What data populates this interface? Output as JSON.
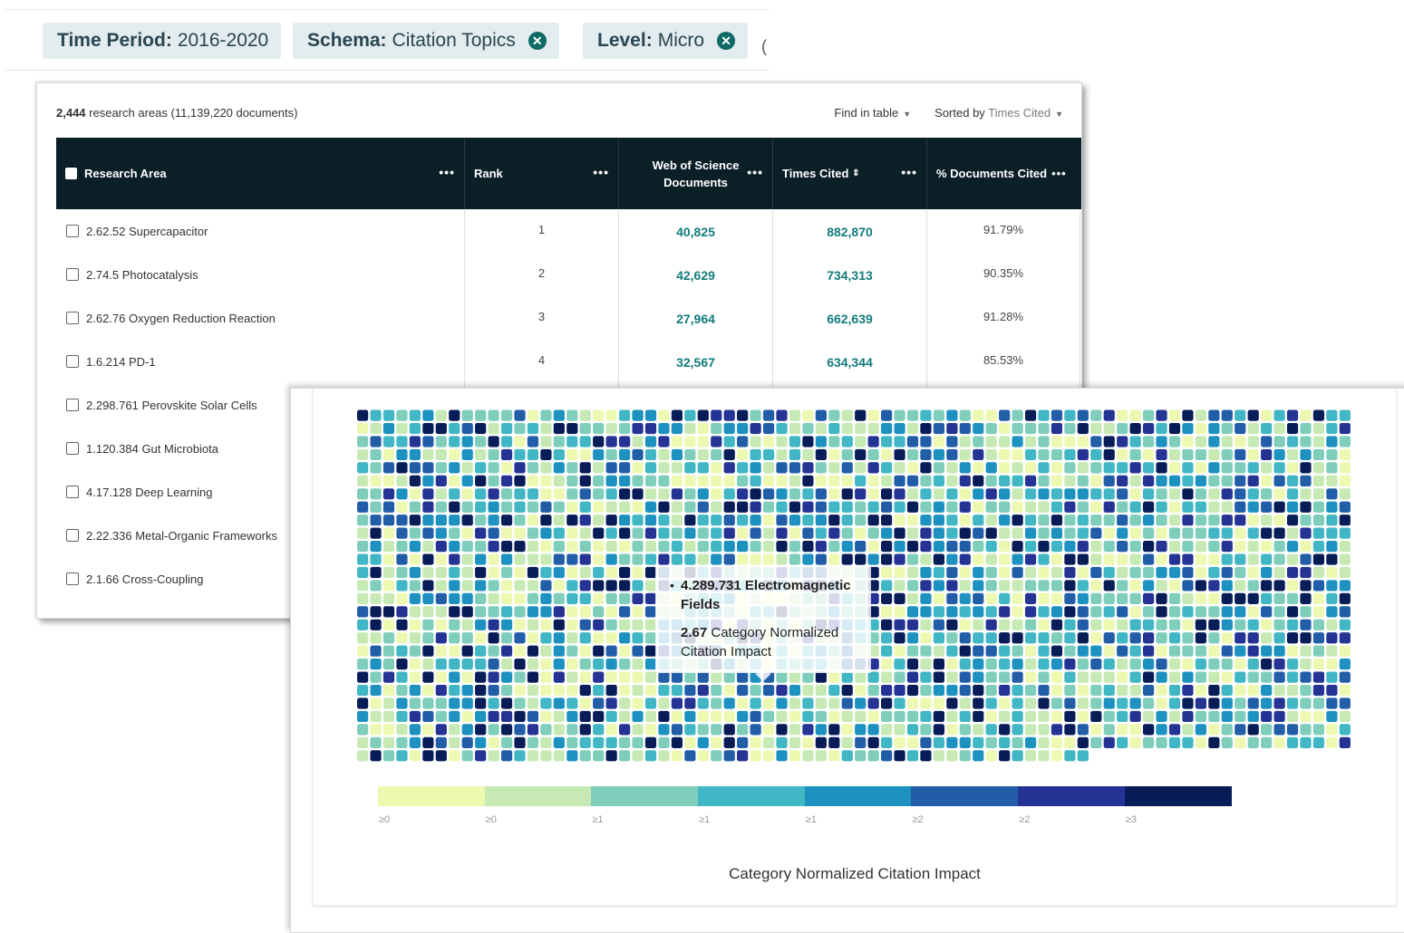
{
  "filters": [
    {
      "label": "Time Period:",
      "value": "2016-2020",
      "removable": false
    },
    {
      "label": "Schema:",
      "value": "Citation Topics",
      "removable": true
    },
    {
      "label": "Level:",
      "value": "Micro",
      "removable": true
    }
  ],
  "table": {
    "count": "2,444",
    "count_suffix": " research areas (11,139,220 documents)",
    "find_label": "Find in table",
    "sorted_prefix": "Sorted by",
    "sorted_value": "Times Cited",
    "columns": {
      "area": "Research Area",
      "rank": "Rank",
      "wos": "Web of Science Documents",
      "cited": "Times Cited",
      "cited_sort_icon": "⇕",
      "pct": "% Documents Cited"
    },
    "rows": [
      {
        "area": "2.62.52 Supercapacitor",
        "rank": "1",
        "wos": "40,825",
        "cited": "882,870",
        "pct": "91.79%"
      },
      {
        "area": "2.74.5 Photocatalysis",
        "rank": "2",
        "wos": "42,629",
        "cited": "734,313",
        "pct": "90.35%"
      },
      {
        "area": "2.62.76 Oxygen Reduction Reaction",
        "rank": "3",
        "wos": "27,964",
        "cited": "662,639",
        "pct": "91.28%"
      },
      {
        "area": "1.6.214 PD-1",
        "rank": "4",
        "wos": "32,567",
        "cited": "634,344",
        "pct": "85.53%"
      },
      {
        "area": "2.298.761 Perovskite Solar Cells",
        "rank": "",
        "wos": "",
        "cited": "",
        "pct": ""
      },
      {
        "area": "1.120.384 Gut Microbiota",
        "rank": "",
        "wos": "",
        "cited": "",
        "pct": ""
      },
      {
        "area": "4.17.128 Deep Learning",
        "rank": "",
        "wos": "",
        "cited": "",
        "pct": ""
      },
      {
        "area": "2.22.336 Metal-Organic Frameworks",
        "rank": "",
        "wos": "",
        "cited": "",
        "pct": ""
      },
      {
        "area": "2.1.66 Cross-Coupling",
        "rank": "",
        "wos": "",
        "cited": "",
        "pct": ""
      }
    ]
  },
  "heatmap": {
    "tooltip_name": "4.289.731 Electromagnetic Fields",
    "tooltip_value": "2.67",
    "tooltip_metric": " Category Normalized Citation Impact",
    "legend_colors": [
      "#edf8b1",
      "#c7e9b4",
      "#7fcdbb",
      "#41b6c4",
      "#1d91c0",
      "#225ea8",
      "#253494",
      "#081d58"
    ],
    "legend_ticks": [
      "≥0",
      "≥0",
      "≥1",
      "≥1",
      "≥1",
      "≥2",
      "≥2",
      "≥3"
    ],
    "legend_title": "Category Normalized Citation Impact"
  }
}
